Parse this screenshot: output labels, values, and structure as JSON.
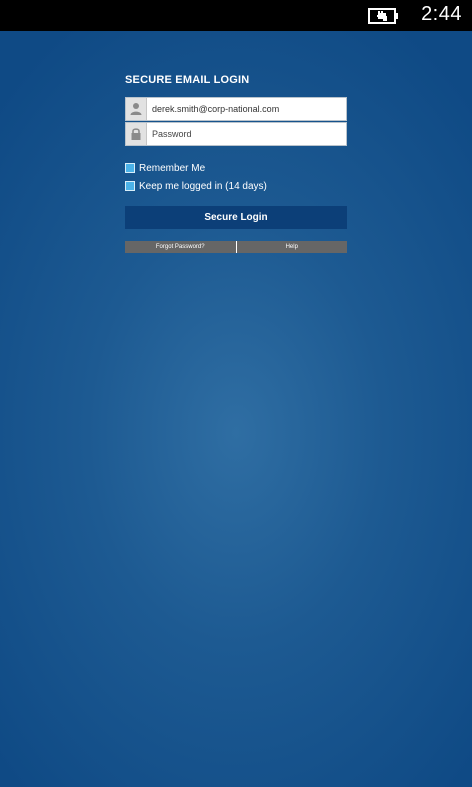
{
  "status_bar": {
    "time": "2:44",
    "battery_icon": "battery-charging-icon"
  },
  "login": {
    "title": "SECURE EMAIL LOGIN",
    "email_value": "derek.smith@corp-national.com",
    "email_icon": "user-icon",
    "password_placeholder": "Password",
    "password_icon": "lock-icon",
    "remember_me_label": "Remember Me",
    "keep_logged_in_label": "Keep me logged in (14 days)",
    "submit_label": "Secure Login",
    "forgot_password_label": "Forgot Password?",
    "help_label": "Help"
  },
  "colors": {
    "background": "#1d5a92",
    "button": "#0c3f78",
    "checkbox": "#4bb2e8",
    "links_bar": "#666666"
  }
}
